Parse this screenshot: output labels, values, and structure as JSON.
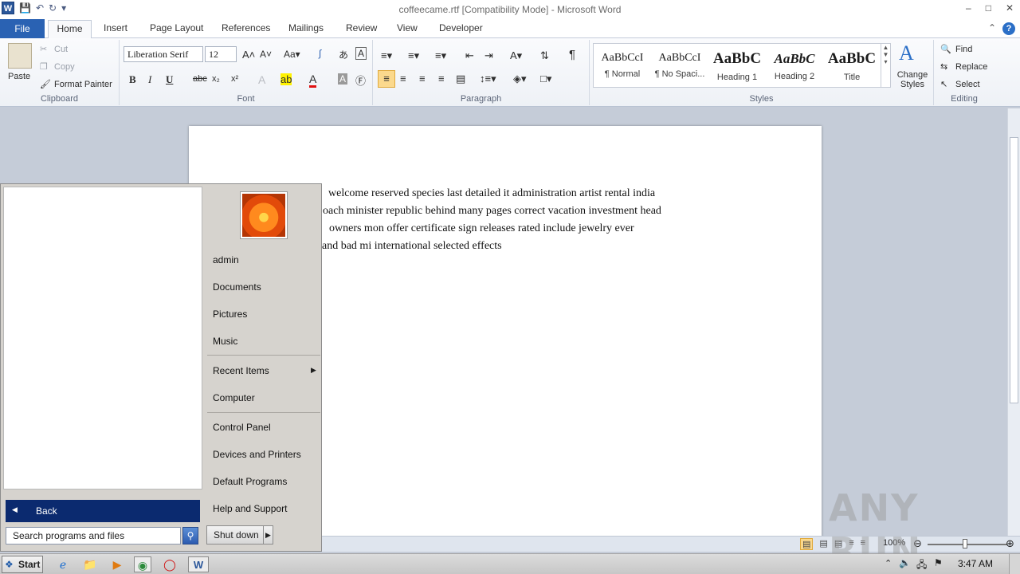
{
  "window": {
    "title": "coffeecame.rtf [Compatibility Mode]  -  Microsoft Word",
    "controls": [
      "–",
      "□",
      "✕"
    ]
  },
  "quick_access": {
    "logo": "W",
    "save_icon": "floppy",
    "undo": "↶",
    "redo": "↻",
    "customize": "▾"
  },
  "tabs": [
    "File",
    "Home",
    "Insert",
    "Page Layout",
    "References",
    "Mailings",
    "Review",
    "View",
    "Developer"
  ],
  "ribbon": {
    "clipboard": {
      "paste": "Paste",
      "cut": "Cut",
      "copy": "Copy",
      "format_painter": "Format Painter",
      "label": "Clipboard"
    },
    "font": {
      "name": "Liberation Serif",
      "size": "12",
      "label": "Font"
    },
    "paragraph": {
      "label": "Paragraph"
    },
    "styles": {
      "label": "Styles",
      "items": [
        {
          "sample": "AaBbCcI",
          "name": "¶ Normal"
        },
        {
          "sample": "AaBbCcI",
          "name": "¶ No Spaci..."
        },
        {
          "sample": "AaBbC",
          "name": "Heading 1"
        },
        {
          "sample": "AaBbC",
          "name": "Heading 2"
        },
        {
          "sample": "AaBbC",
          "name": "Title"
        }
      ],
      "change_styles": "Change Styles"
    },
    "editing": {
      "find": "Find",
      "replace": "Replace",
      "select": "Select",
      "label": "Editing"
    }
  },
  "document": {
    "lines": [
      "welcome      reserved  species  last     detailed  it     administration  artist     rental  india",
      "oach minister  republic  behind  many  pages correct vacation  investment           head",
      "owners     mon  offer  certificate     sign  releases  rated include          jewelry      ever",
      "and       bad mi  international        selected  effects"
    ]
  },
  "status": {
    "zoom": "100%"
  },
  "start_menu": {
    "items": [
      "admin",
      "Documents",
      "Pictures",
      "Music",
      "Recent Items",
      "Computer",
      "Control Panel",
      "Devices and Printers",
      "Default Programs",
      "Help and Support"
    ],
    "back": "Back",
    "search_placeholder": "Search programs and files",
    "shutdown": "Shut down"
  },
  "taskbar": {
    "start": "Start",
    "time": "3:47 AM"
  },
  "watermark": "ANY RUN"
}
